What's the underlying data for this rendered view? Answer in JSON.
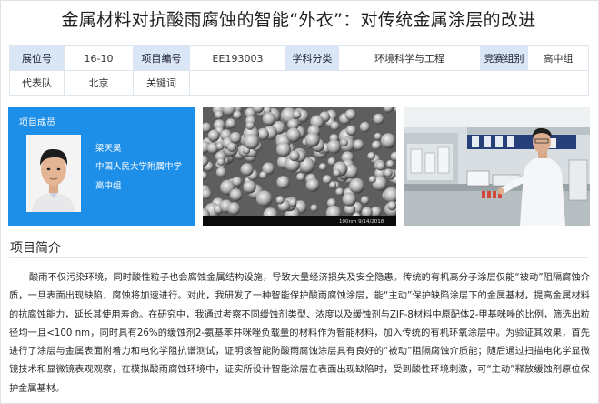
{
  "title": "金属材料对抗酸雨腐蚀的智能“外衣”：对传统金属涂层的改进",
  "info": {
    "booth_label": "展位号",
    "booth_value": "16-10",
    "project_no_label": "项目编号",
    "project_no_value": "EE193003",
    "subject_label": "学科分类",
    "subject_value": "环境科学与工程",
    "group_label": "竞赛组别",
    "group_value": "高中组",
    "team_label": "代表队",
    "team_value": "北京",
    "keywords_label": "关键词",
    "keywords_value": ""
  },
  "member": {
    "header": "项目成员",
    "name": "梁天昊",
    "school": "中国人民大学附属中学",
    "grade": "高中组"
  },
  "sem_caption": "100nm  9/14/2018",
  "section": {
    "title": "项目简介",
    "body": "酸雨不仅污染环境，同时酸性粒子也会腐蚀金属结构设施，导致大量经济损失及安全隐患。传统的有机高分子涂层仅能“被动”阻隔腐蚀介质，一旦表面出现缺陷，腐蚀将加速进行。对此，我研发了一种智能保护酸雨腐蚀涂层，能“主动”保护缺陷涂层下的金属基材，提高金属材料的抗腐蚀能力，延长其使用寿命。在研究中，我通过考察不同缓蚀剂类型、浓度以及缓蚀剂与ZIF-8材料中原配体2-甲基咪唑的比例，筛选出粒径均一且<100 nm，同时具有26%的缓蚀剂2-氨基苯并咪唑负载量的材料作为智能材料，加入传统的有机环氧涂层中。为验证其效果，首先进行了涂层与金属表面附着力和电化学阻抗谱测试，证明该智能防酸雨腐蚀涂层具有良好的“被动”阻隔腐蚀介质能；随后通过扫描电化学显微镜技术和显微镜表观观察，在模拟酸雨腐蚀环境中，证实所设计智能涂层在表面出现缺陷时，受到酸性环境刺激，可“主动”释放缓蚀剂原位保护金属基材。"
  }
}
